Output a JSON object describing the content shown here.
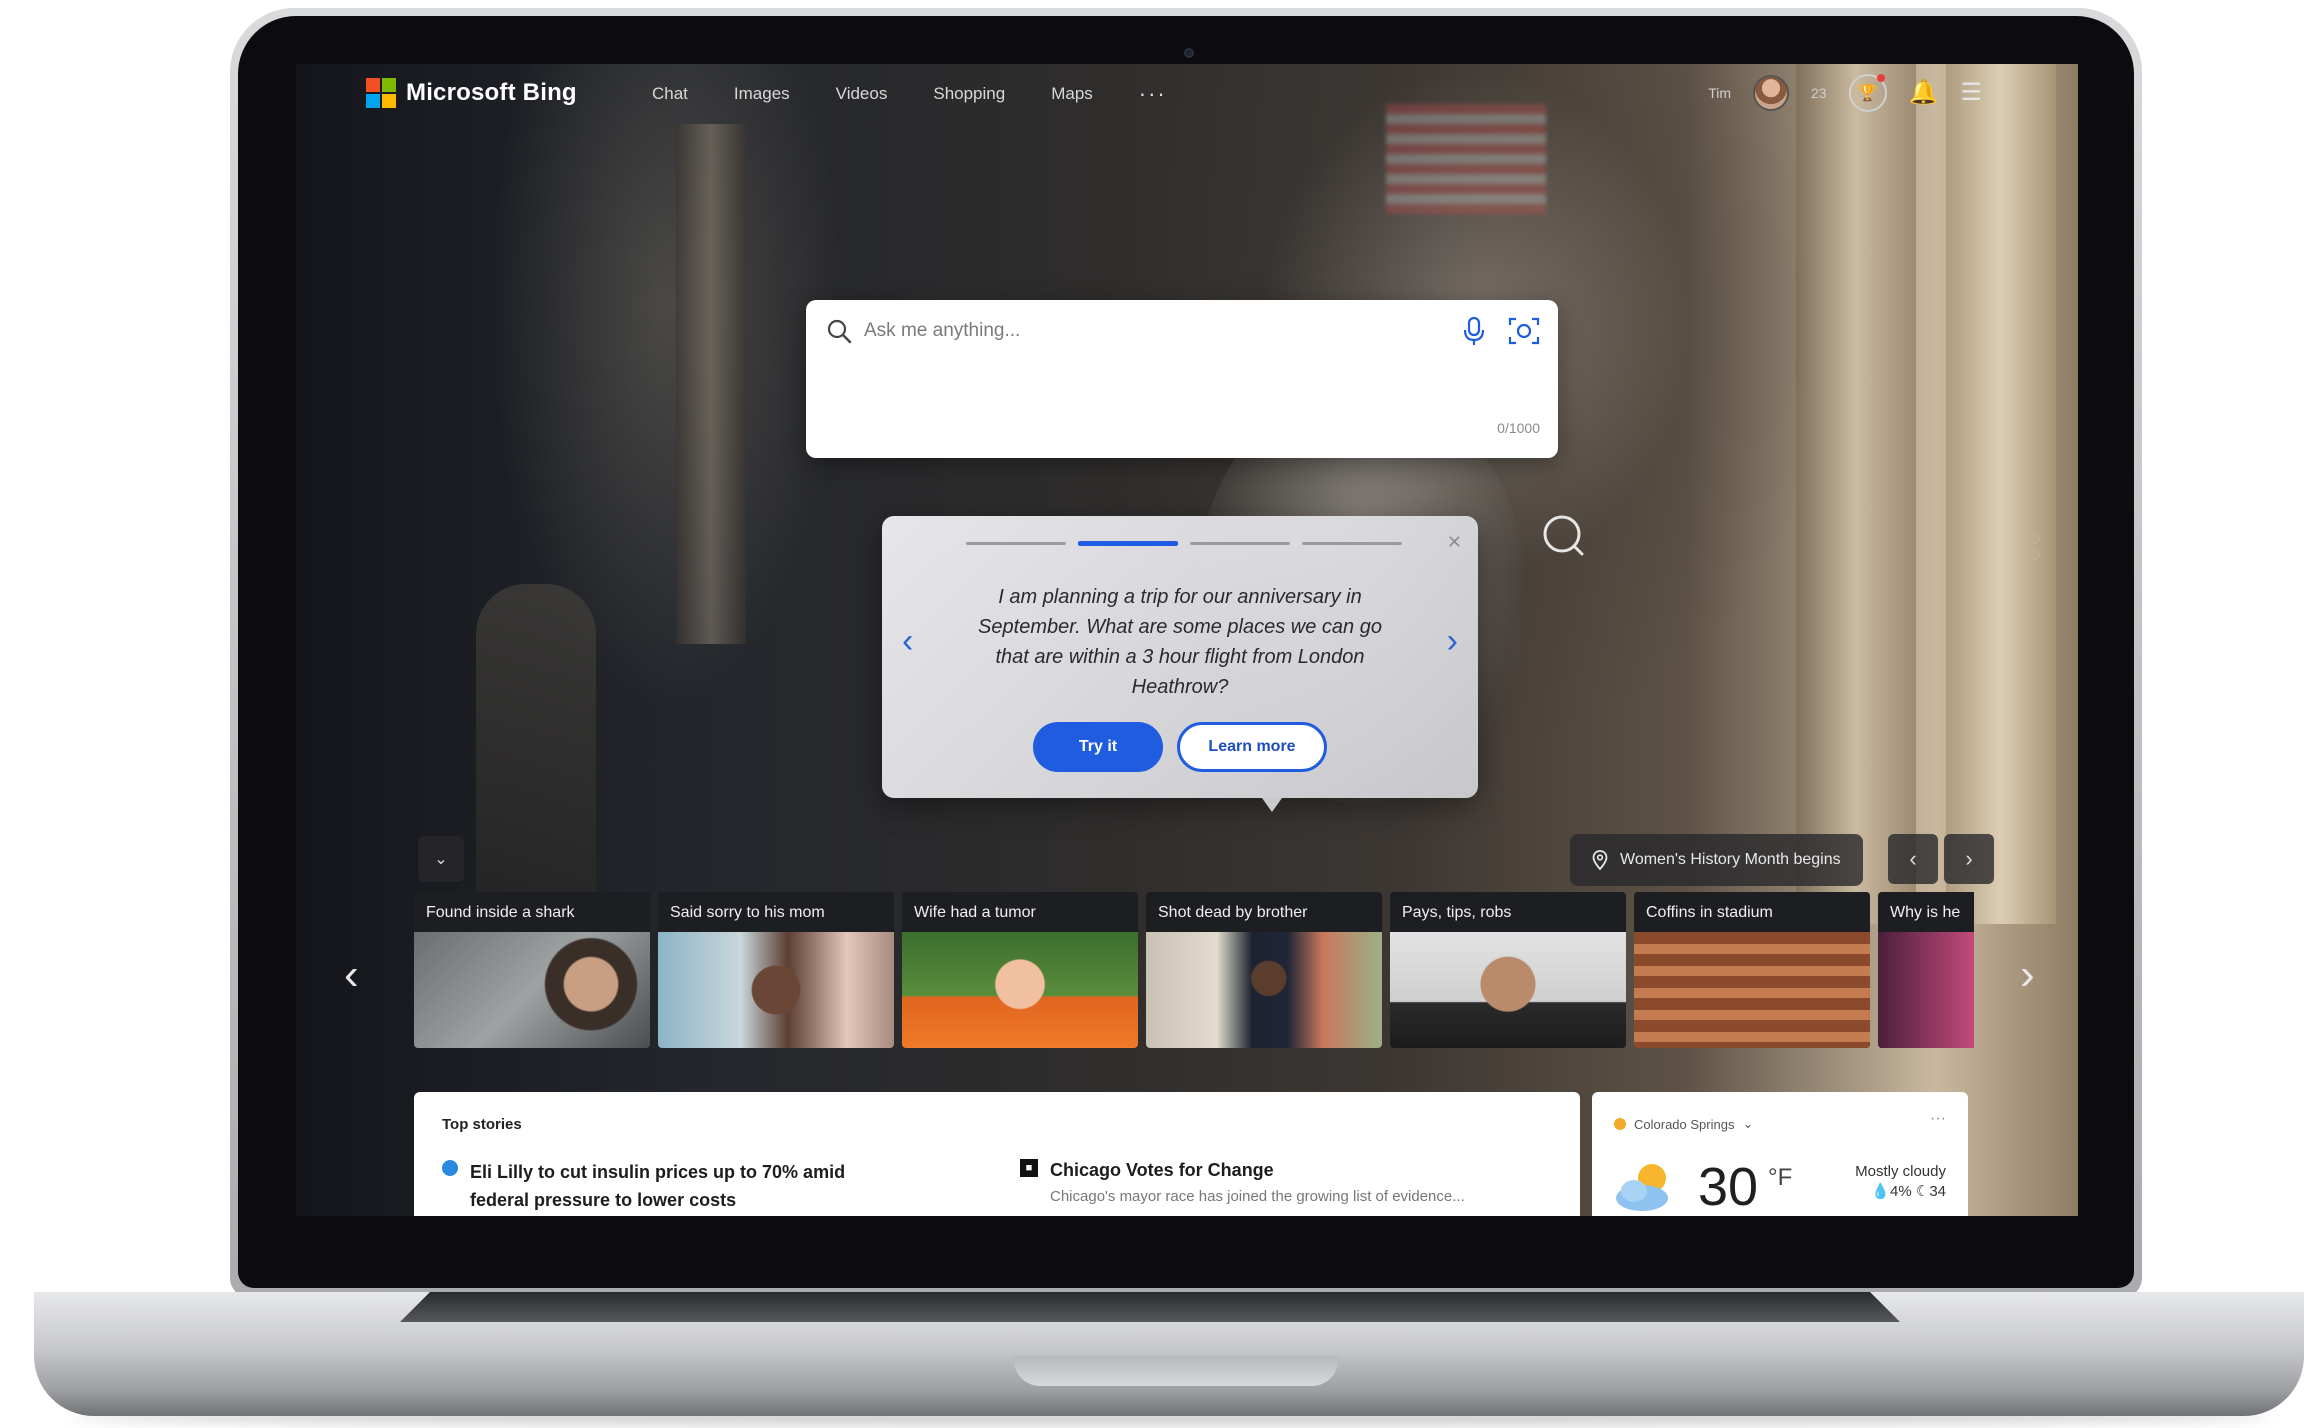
{
  "nav": {
    "brand": "Microsoft Bing",
    "items": [
      "Chat",
      "Images",
      "Videos",
      "Shopping",
      "Maps"
    ],
    "more": "···",
    "user_name": "Tim",
    "points": "23"
  },
  "search": {
    "placeholder": "Ask me anything...",
    "char_count": "0/1000"
  },
  "tip": {
    "text": "I am planning a trip for our anniversary in September. What are some places we can go that are within a 3 hour flight from London Heathrow?",
    "try_label": "Try it",
    "learn_label": "Learn more",
    "close": "✕",
    "prev": "‹",
    "next": "›"
  },
  "carousel": {
    "collapse": "⌄",
    "location_label": "Women's History Month begins",
    "pill_prev": "‹",
    "pill_next": "›",
    "prev": "‹",
    "next": "›",
    "tiles": [
      {
        "title": "Found inside a shark"
      },
      {
        "title": "Said sorry to his mom"
      },
      {
        "title": "Wife had a tumor"
      },
      {
        "title": "Shot dead by brother"
      },
      {
        "title": "Pays, tips, robs"
      },
      {
        "title": "Coffins in stadium"
      },
      {
        "title": "Why is he"
      }
    ]
  },
  "top_stories": {
    "heading": "Top stories",
    "story1": {
      "badge": "",
      "title": "Eli Lilly to cut insulin prices up to 70% amid federal pressure to lower costs"
    },
    "story2": {
      "badge": "■",
      "title": "Chicago Votes for Change",
      "snippet": "Chicago's mayor race has joined the growing list of evidence..."
    }
  },
  "weather": {
    "location": "Colorado Springs",
    "more": "···",
    "temp": "30",
    "unit": "°F",
    "condition": "Mostly cloudy",
    "details": "💧4%  ☾34"
  },
  "colors": {
    "accent": "#1f5ce0",
    "ms_red": "#f25022",
    "ms_green": "#7fba00",
    "ms_blue": "#00a4ef",
    "ms_yellow": "#ffb900"
  },
  "icons": [
    "search-icon",
    "microphone-icon",
    "camera-search-icon",
    "visual-search-icon",
    "bell-icon",
    "menu-icon",
    "rewards-icon",
    "location-pin-icon",
    "chevron-left-icon",
    "chevron-right-icon",
    "chevron-down-icon",
    "close-icon",
    "weather-cloud-sun-icon"
  ]
}
